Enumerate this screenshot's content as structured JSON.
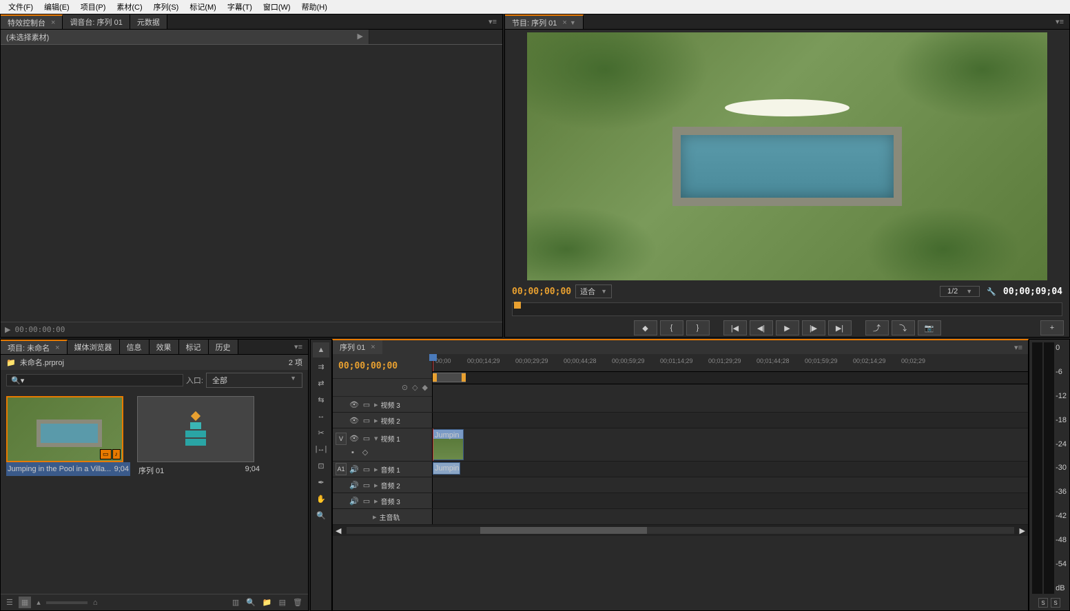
{
  "menu": {
    "items": [
      "文件(F)",
      "编辑(E)",
      "项目(P)",
      "素材(C)",
      "序列(S)",
      "标记(M)",
      "字幕(T)",
      "窗口(W)",
      "帮助(H)"
    ]
  },
  "effectPanel": {
    "tabs": [
      "特效控制台",
      "调音台: 序列 01",
      "元数据"
    ],
    "sourceLabel": "(未选择素材)",
    "footerTc": "00:00:00:00"
  },
  "programPanel": {
    "tabLabel": "节目: 序列 01",
    "currentTc": "00;00;00;00",
    "fitLabel": "适合",
    "resolutionLabel": "1/2",
    "duration": "00;00;09;04"
  },
  "projectPanel": {
    "tabs": [
      "项目: 未命名",
      "媒体浏览器",
      "信息",
      "效果",
      "标记",
      "历史"
    ],
    "projectName": "未命名.prproj",
    "itemCount": "2 项",
    "filterLabel": "入口:",
    "filterValue": "全部",
    "bins": [
      {
        "name": "Jumping in the Pool in a Villa...",
        "duration": "9;04"
      },
      {
        "name": "序列 01",
        "duration": "9;04"
      }
    ]
  },
  "timeline": {
    "tabLabel": "序列 01",
    "currentTc": "00;00;00;00",
    "ruler": [
      "00;00",
      "00;00;14;29",
      "00;00;29;29",
      "00;00;44;28",
      "00;00;59;29",
      "00;01;14;29",
      "00;01;29;29",
      "00;01;44;28",
      "00;01;59;29",
      "00;02;14;29",
      "00;02;29"
    ],
    "tracks": {
      "v3": "视频 3",
      "v2": "视频 2",
      "v1": "视频 1",
      "a1": "音频 1",
      "a2": "音频 2",
      "a3": "音频 3",
      "master": "主音轨"
    },
    "v1Target": "V",
    "a1Target": "A1",
    "clipLabel": "Jumpin"
  },
  "audioMeter": {
    "scale": [
      "0",
      "-6",
      "-12",
      "-18",
      "-24",
      "-30",
      "-36",
      "-42",
      "-48",
      "-54",
      "dB"
    ],
    "soloLabel": "S"
  }
}
